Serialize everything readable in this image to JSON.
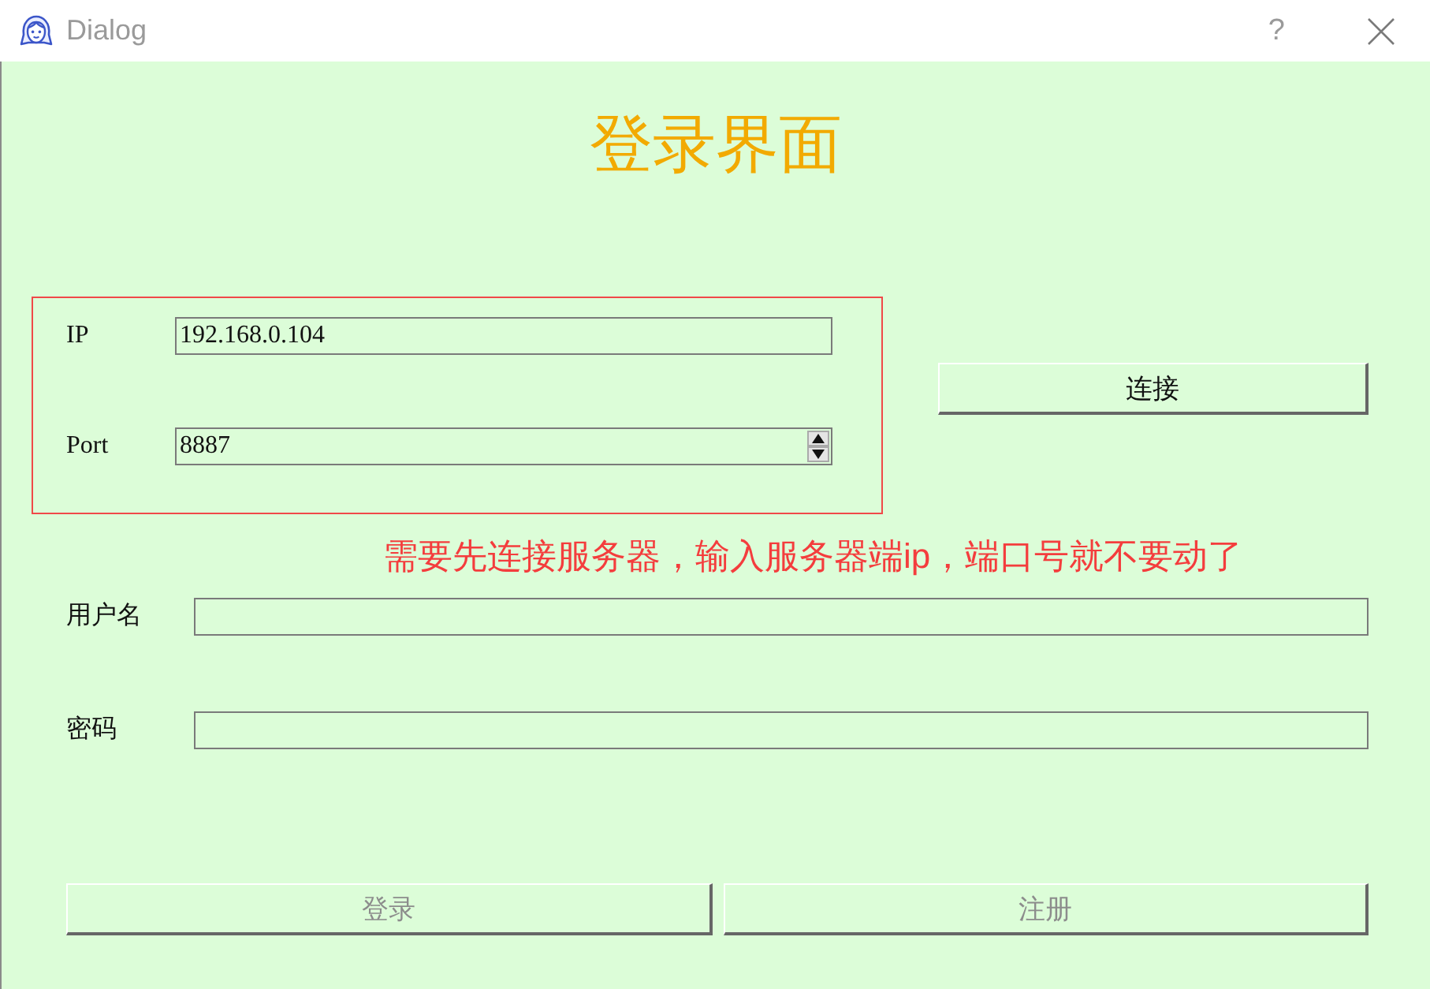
{
  "window": {
    "title": "Dialog",
    "help": "?"
  },
  "heading": "登录界面",
  "connection": {
    "fields": [
      {
        "label": "IP",
        "value": "192.168.0.104",
        "kind": "text"
      },
      {
        "label": "Port",
        "value": "8887",
        "kind": "spin"
      }
    ],
    "connect_button": {
      "label": "连接",
      "disabled": false
    }
  },
  "annotation": "需要先连接服务器，输入服务器端ip，端口号就不要动了",
  "login_fields": [
    {
      "label": "用户名"
    },
    {
      "label": "密码"
    }
  ],
  "buttons": [
    {
      "label": "登录",
      "disabled": true
    },
    {
      "label": "注册",
      "disabled": true
    }
  ]
}
